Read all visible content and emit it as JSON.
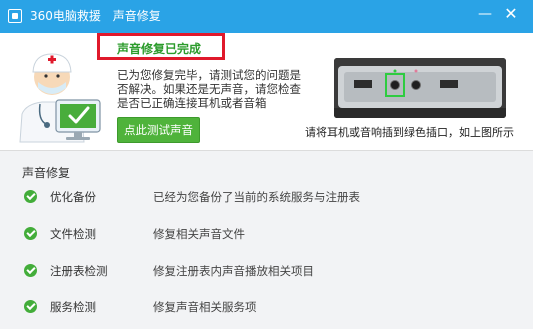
{
  "window": {
    "app_name": "360电脑救援",
    "page_name": "声音修复",
    "minimize_glyph": "—",
    "close_glyph": "✕"
  },
  "result": {
    "title": "声音修复已完成",
    "description": "已为您修复完毕，请测试您的问题是否解决。如果还是无声音，请您检查是否已正确连接耳机或者音箱",
    "test_button": "点此测试声音",
    "port_caption": "请将耳机或音响插到绿色插口，如上图所示"
  },
  "repair": {
    "section_title": "声音修复",
    "items": [
      {
        "name": "优化备份",
        "desc": "已经为您备份了当前的系统服务与注册表"
      },
      {
        "name": "文件检测",
        "desc": "修复相关声音文件"
      },
      {
        "name": "注册表检测",
        "desc": "修复注册表内声音播放相关项目"
      },
      {
        "name": "服务检测",
        "desc": "修复声音相关服务项"
      }
    ]
  },
  "colors": {
    "titlebar": "#2aa3e6",
    "success_green": "#43ad3a",
    "highlight_red": "#e0192b"
  },
  "icons": {
    "app": "app-logo-icon",
    "doctor": "doctor-monitor-icon",
    "check": "check-icon"
  }
}
